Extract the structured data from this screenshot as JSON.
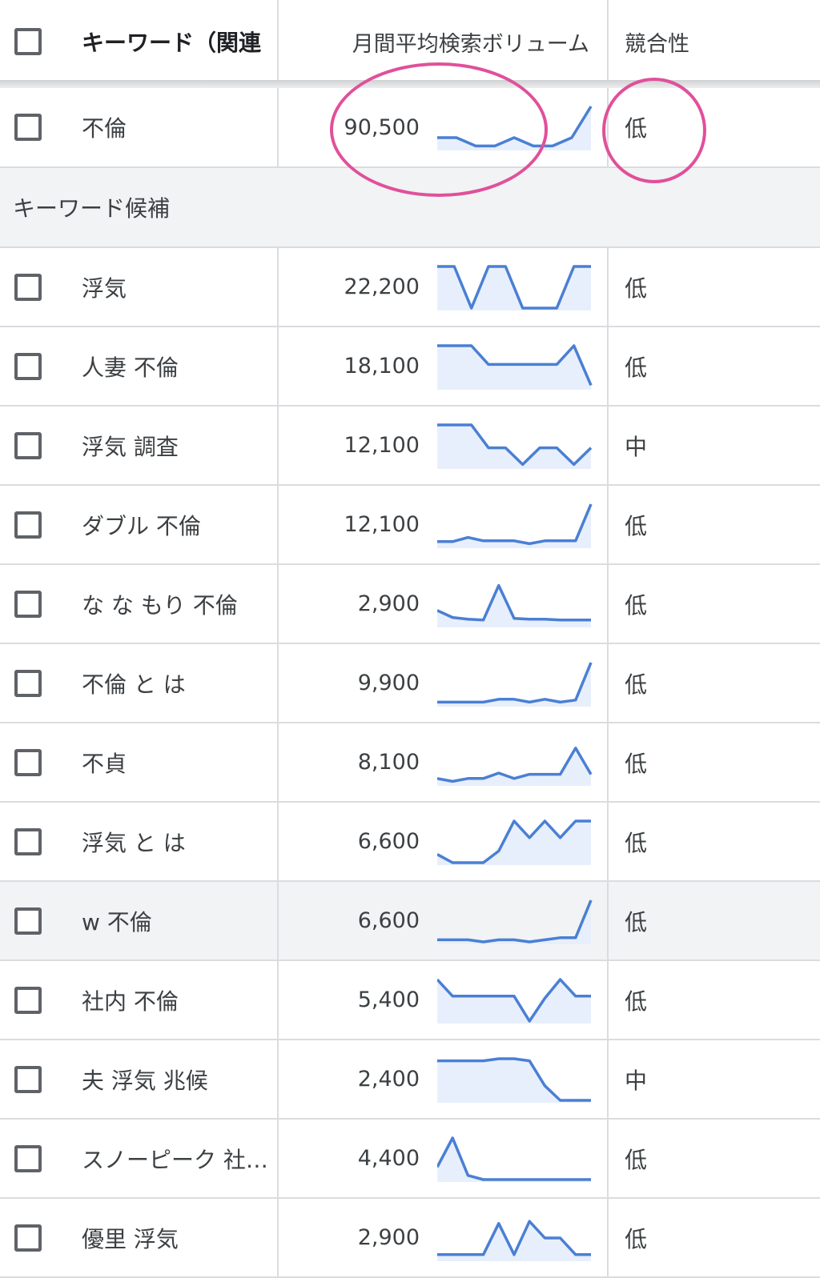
{
  "header": {
    "keyword_col": "キーワード（関連",
    "volume_col": "月間平均検索ボリューム",
    "competition_col": "競合性"
  },
  "primary": {
    "keyword": "不倫",
    "volume": "90,500",
    "competition": "低",
    "trend": [
      0.25,
      0.25,
      0.05,
      0.05,
      0.25,
      0.05,
      0.05,
      0.25,
      1.0
    ]
  },
  "section_label": "キーワード候補",
  "rows": [
    {
      "keyword": "浮気",
      "volume": "22,200",
      "competition": "低",
      "trend": [
        1.0,
        1.0,
        0.0,
        1.0,
        1.0,
        0.0,
        0.0,
        0.0,
        1.0,
        1.0
      ]
    },
    {
      "keyword": "人妻 不倫",
      "volume": "18,100",
      "competition": "低",
      "trend": [
        1.0,
        1.0,
        1.0,
        0.55,
        0.55,
        0.55,
        0.55,
        0.55,
        1.0,
        0.05
      ]
    },
    {
      "keyword": "浮気 調査",
      "volume": "12,100",
      "competition": "中",
      "trend": [
        1.0,
        1.0,
        1.0,
        0.45,
        0.45,
        0.05,
        0.45,
        0.45,
        0.05,
        0.45
      ]
    },
    {
      "keyword": "ダブル 不倫",
      "volume": "12,100",
      "competition": "低",
      "trend": [
        0.1,
        0.1,
        0.2,
        0.12,
        0.12,
        0.12,
        0.05,
        0.12,
        0.12,
        0.12,
        1.0
      ]
    },
    {
      "keyword": "な な もり 不倫",
      "volume": "2,900",
      "competition": "低",
      "trend": [
        0.35,
        0.18,
        0.14,
        0.12,
        0.95,
        0.16,
        0.14,
        0.14,
        0.12,
        0.12,
        0.12
      ]
    },
    {
      "keyword": "不倫 と は",
      "volume": "9,900",
      "competition": "低",
      "trend": [
        0.05,
        0.05,
        0.05,
        0.05,
        0.12,
        0.12,
        0.05,
        0.12,
        0.05,
        0.1,
        1.0
      ]
    },
    {
      "keyword": "不貞",
      "volume": "8,100",
      "competition": "低",
      "trend": [
        0.12,
        0.05,
        0.12,
        0.12,
        0.25,
        0.12,
        0.22,
        0.22,
        0.22,
        0.85,
        0.22
      ]
    },
    {
      "keyword": "浮気 と は",
      "volume": "6,600",
      "competition": "低",
      "trend": [
        0.2,
        0.0,
        0.0,
        0.0,
        0.28,
        1.0,
        0.6,
        1.0,
        0.6,
        1.0,
        1.0
      ]
    },
    {
      "keyword": "w 不倫",
      "volume": "6,600",
      "competition": "低",
      "trend": [
        0.05,
        0.05,
        0.05,
        0.0,
        0.05,
        0.05,
        0.0,
        0.05,
        0.1,
        0.1,
        1.0
      ]
    },
    {
      "keyword": "社内 不倫",
      "volume": "5,400",
      "competition": "低",
      "trend": [
        1.0,
        0.6,
        0.6,
        0.6,
        0.6,
        0.6,
        0.0,
        0.55,
        1.0,
        0.6,
        0.6
      ]
    },
    {
      "keyword": "夫 浮気 兆候",
      "volume": "2,400",
      "competition": "中",
      "trend": [
        0.95,
        0.95,
        0.95,
        0.95,
        1.0,
        1.0,
        0.95,
        0.35,
        0.0,
        0.0,
        0.0
      ]
    },
    {
      "keyword": "スノーピーク 社…",
      "volume": "4,400",
      "competition": "低",
      "trend": [
        0.3,
        1.0,
        0.1,
        0.0,
        0.0,
        0.0,
        0.0,
        0.0,
        0.0,
        0.0,
        0.0
      ]
    },
    {
      "keyword": "優里 浮気",
      "volume": "2,900",
      "competition": "低",
      "trend": [
        0.1,
        0.1,
        0.1,
        0.1,
        0.85,
        0.1,
        0.9,
        0.5,
        0.5,
        0.1,
        0.1
      ]
    }
  ],
  "highlighted_row_index": 8,
  "annotation_color": "#e0509a",
  "sparkline_color": "#4a7fd4",
  "sparkline_fill": "#e8effc"
}
